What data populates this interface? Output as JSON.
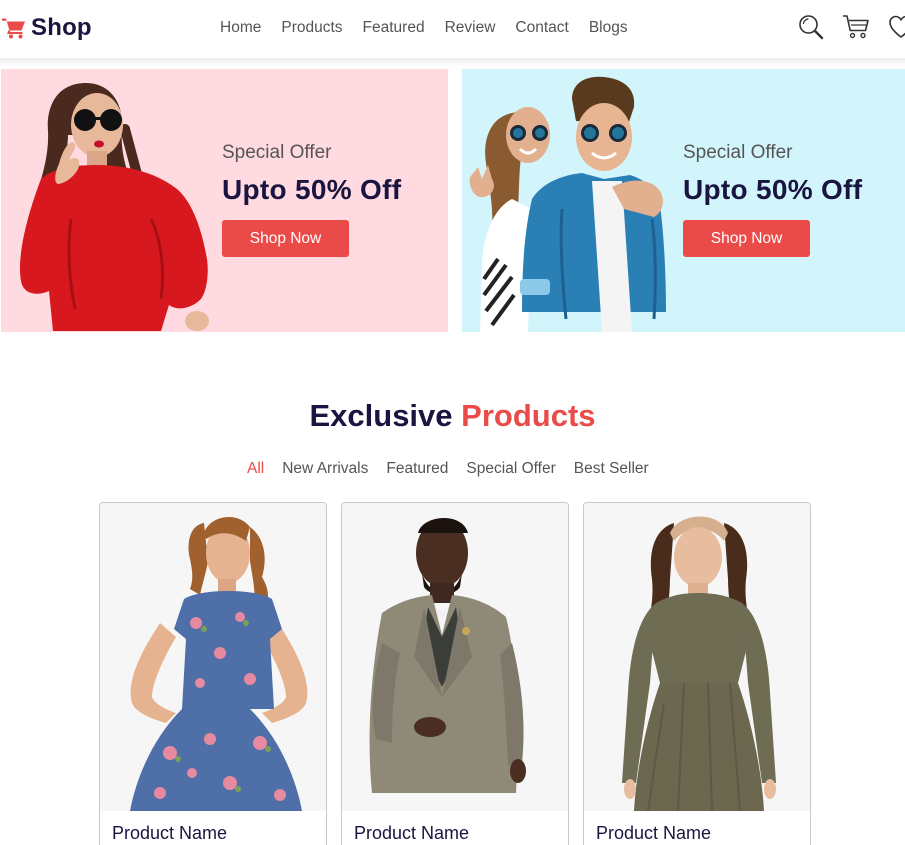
{
  "brand": {
    "name": "Shop",
    "logo_icon": "cart-icon",
    "accent_color": "#ea4b48"
  },
  "nav": {
    "items": [
      "Home",
      "Products",
      "Featured",
      "Review",
      "Contact",
      "Blogs"
    ],
    "actions": [
      "search-icon",
      "cart-icon",
      "heart-icon"
    ]
  },
  "banners": [
    {
      "subtitle": "Special Offer",
      "title": "Upto 50% Off",
      "button": "Shop Now",
      "background": "#ffdbe1"
    },
    {
      "subtitle": "Special Offer",
      "title": "Upto 50% Off",
      "button": "Shop Now",
      "background": "#d2f5fc"
    }
  ],
  "section": {
    "title_main": "Exclusive",
    "title_accent": "Products",
    "filters": [
      "All",
      "New Arrivals",
      "Featured",
      "Special Offer",
      "Best Seller"
    ],
    "active_filter": "All"
  },
  "products": [
    {
      "name": "Product Name"
    },
    {
      "name": "Product Name"
    },
    {
      "name": "Product Name"
    }
  ],
  "colors": {
    "dark": "#1a1540",
    "accent": "#ea4b48",
    "muted": "#555555"
  }
}
